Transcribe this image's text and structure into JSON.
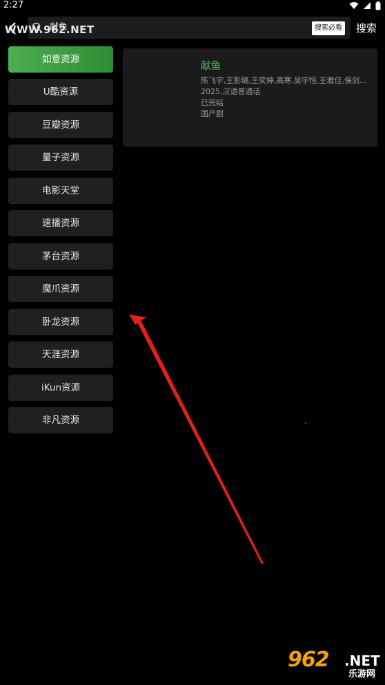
{
  "status_bar": {
    "time": "2:27",
    "icons": [
      "wifi-icon",
      "signal-icon",
      "battery-icon"
    ]
  },
  "top_bar": {
    "search_value": "献鱼",
    "search_tag": "搜索必看",
    "search_button": "搜索",
    "watermark": "WWW.962.NET"
  },
  "sources": [
    {
      "label": "如意资源",
      "active": true
    },
    {
      "label": "U酷资源",
      "active": false
    },
    {
      "label": "豆瓣资源",
      "active": false
    },
    {
      "label": "量子资源",
      "active": false
    },
    {
      "label": "电影天堂",
      "active": false
    },
    {
      "label": "速播资源",
      "active": false
    },
    {
      "label": "茅台资源",
      "active": false
    },
    {
      "label": "魔爪资源",
      "active": false
    },
    {
      "label": "卧龙资源",
      "active": false
    },
    {
      "label": "天涯资源",
      "active": false
    },
    {
      "label": "iKun资源",
      "active": false
    },
    {
      "label": "非凡资源",
      "active": false
    }
  ],
  "result": {
    "title": "献鱼",
    "cast": "陈飞宇,王影璐,王奕婷,高寒,吴宇恒,王雅佳,保剑...",
    "year_lang": "2025,汉语普通话",
    "status": "已完结",
    "category": "国产剧"
  },
  "watermark_bottom": {
    "logo": "962",
    "net": ".NET",
    "sub": "乐游网"
  },
  "colors": {
    "accent_green": "#4cae4f",
    "title_green": "#58b85f",
    "arrow_red": "#e0201c",
    "watermark_orange": "#f4a300"
  }
}
